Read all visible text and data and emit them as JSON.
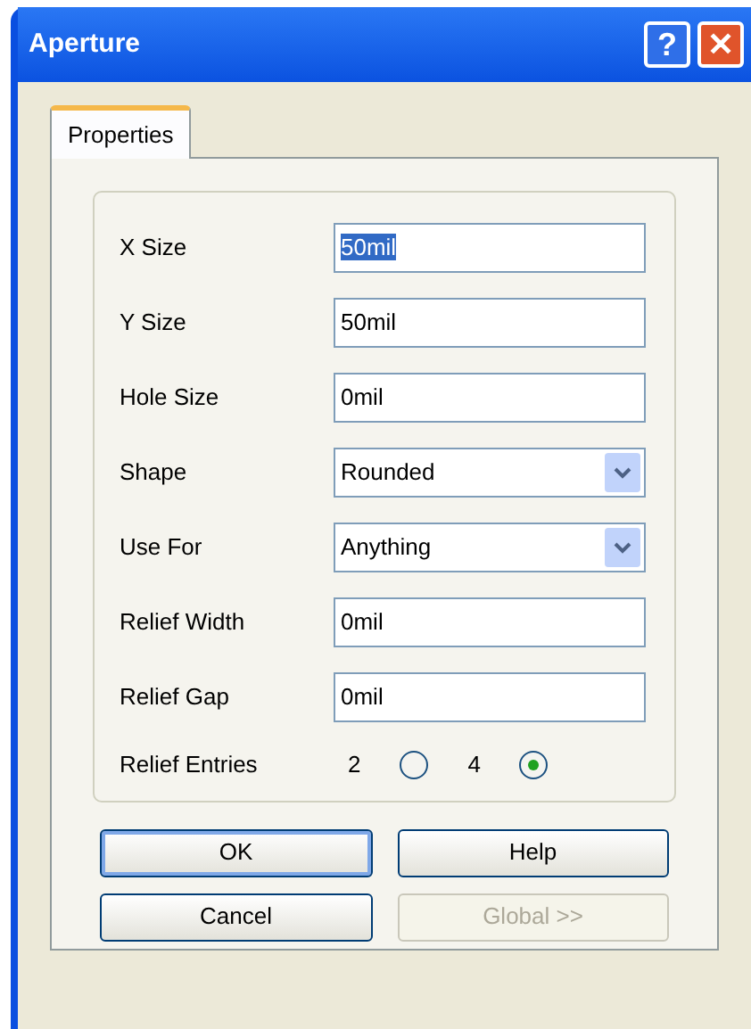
{
  "window": {
    "title": "Aperture"
  },
  "title_buttons": [
    {
      "kind": "help",
      "label": "?"
    },
    {
      "kind": "close",
      "label": "✕"
    }
  ],
  "tabs": [
    {
      "label": "Properties",
      "selected": true
    }
  ],
  "fields": [
    {
      "label": "X Size",
      "kind": "text",
      "value": "50mil",
      "text_selected": true
    },
    {
      "label": "Y Size",
      "kind": "text",
      "value": "50mil",
      "text_selected": false
    },
    {
      "label": "Hole Size",
      "kind": "text",
      "value": "0mil",
      "text_selected": false
    },
    {
      "label": "Shape",
      "kind": "dropdown",
      "value": "Rounded",
      "text_selected": false
    },
    {
      "label": "Use For",
      "kind": "dropdown",
      "value": "Anything",
      "text_selected": false
    },
    {
      "label": "Relief Width",
      "kind": "text",
      "value": "0mil",
      "text_selected": false
    },
    {
      "label": "Relief Gap",
      "kind": "text",
      "value": "0mil",
      "text_selected": false
    }
  ],
  "relief_entries": {
    "label": "Relief Entries",
    "options": [
      {
        "label": "2",
        "selected": false
      },
      {
        "label": "4",
        "selected": true
      }
    ]
  },
  "buttons": [
    {
      "label": "OK",
      "default": true,
      "disabled": false
    },
    {
      "label": "Help",
      "default": false,
      "disabled": false
    },
    {
      "label": "Cancel",
      "default": false,
      "disabled": false
    },
    {
      "label": "Global >>",
      "default": false,
      "disabled": true
    }
  ]
}
